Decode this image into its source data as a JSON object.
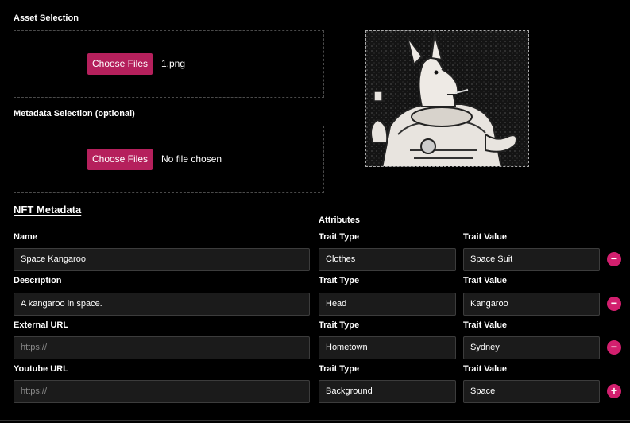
{
  "asset": {
    "label": "Asset Selection",
    "button": "Choose Files",
    "file": "1.png"
  },
  "metadata_file": {
    "label": "Metadata Selection (optional)",
    "button": "Choose Files",
    "file": "No file chosen"
  },
  "preview": {
    "icon": "space-kangaroo-image"
  },
  "nft": {
    "title": "NFT Metadata",
    "name_label": "Name",
    "name_value": "Space Kangaroo",
    "description_label": "Description",
    "description_value": "A kangaroo in space.",
    "external_label": "External URL",
    "external_placeholder": "https://",
    "youtube_label": "Youtube URL",
    "youtube_placeholder": "https://"
  },
  "attributes": {
    "label": "Attributes",
    "type_label": "Trait Type",
    "value_label": "Trait Value",
    "rows": [
      {
        "type": "Clothes",
        "value": "Space Suit",
        "action": "−"
      },
      {
        "type": "Head",
        "value": "Kangaroo",
        "action": "−"
      },
      {
        "type": "Hometown",
        "value": "Sydney",
        "action": "−"
      },
      {
        "type": "Background",
        "value": "Space",
        "action": "+"
      }
    ]
  },
  "colors": {
    "accent": "#b5205c",
    "round_button": "#d21f6e",
    "field_bg": "#1b1b1b"
  }
}
